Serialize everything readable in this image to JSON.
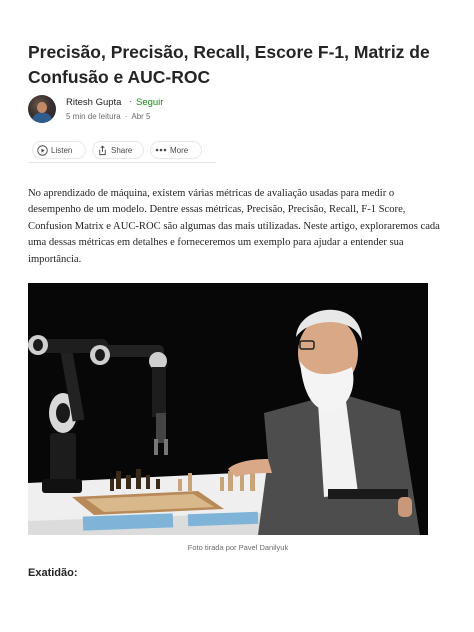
{
  "article": {
    "title": "Precisão, Precisão, Recall, Escore F-1, Matriz de Confusão e AUC-ROC",
    "author": {
      "name": "Ritesh Gupta",
      "separator": "·",
      "follow_label": "Seguir",
      "read_time": "5 min de leitura",
      "meta_separator": "·",
      "date": "Abr 5"
    },
    "actions": {
      "listen_label": "Listen",
      "share_label": "Share",
      "more_label": "More"
    },
    "intro_paragraph": "No aprendizado de máquina, existem várias métricas de avaliação usadas para medir o desempenho de um modelo. Dentre essas métricas, Precisão, Precisão, Recall, F-1 Score, Confusion Matrix e AUC-ROC são algumas das mais utilizadas. Neste artigo, exploraremos cada uma dessas métricas em detalhes e forneceremos um exemplo para ajudar a entender sua importância.",
    "image_caption": "Foto tirada por Pavel Danilyuk",
    "section_heading": "Exatidão:"
  },
  "icons": {
    "listen": "play-circle-icon",
    "share": "share-icon",
    "more": "more-dots-icon"
  },
  "colors": {
    "follow": "#1a8917",
    "text": "#242424",
    "muted": "#6b6b6b",
    "photo_background": "#070707"
  }
}
